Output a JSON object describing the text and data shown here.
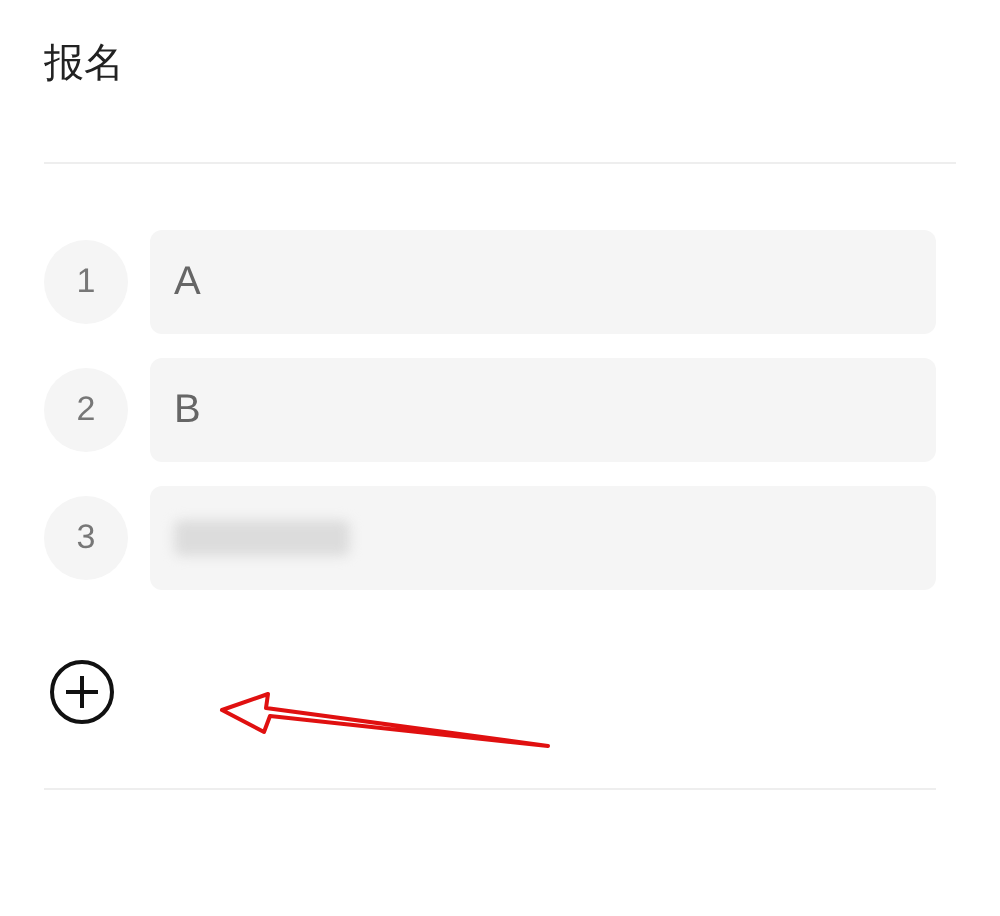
{
  "title": "报名",
  "options": [
    {
      "number": "1",
      "kind": "text",
      "value": "A"
    },
    {
      "number": "2",
      "kind": "text",
      "value": "B"
    },
    {
      "number": "3",
      "kind": "blurred"
    }
  ]
}
